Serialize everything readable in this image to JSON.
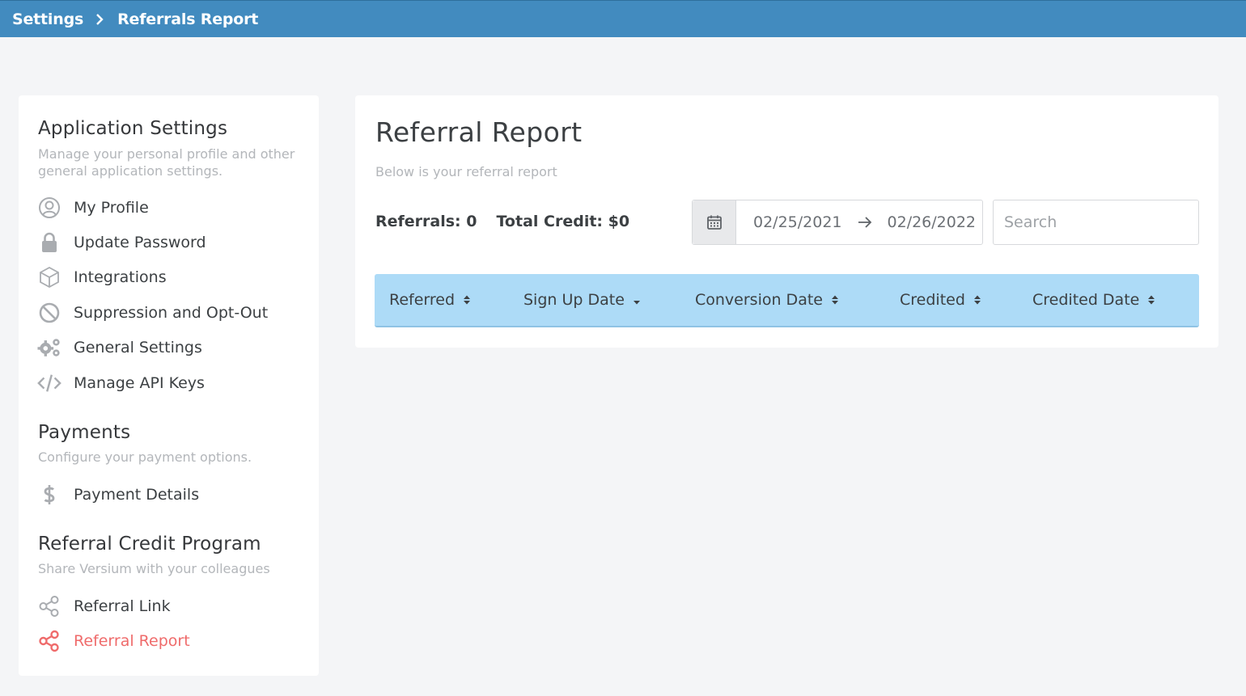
{
  "breadcrumb": {
    "items": [
      "Settings",
      "Referrals Report"
    ]
  },
  "sidebar": {
    "sections": [
      {
        "title": "Application Settings",
        "description": "Manage your personal profile and other general application settings.",
        "items": [
          {
            "label": "My Profile",
            "icon": "user-circle-icon"
          },
          {
            "label": "Update Password",
            "icon": "lock-icon"
          },
          {
            "label": "Integrations",
            "icon": "cube-icon"
          },
          {
            "label": "Suppression and Opt-Out",
            "icon": "ban-icon"
          },
          {
            "label": "General Settings",
            "icon": "gears-icon"
          },
          {
            "label": "Manage API Keys",
            "icon": "code-icon"
          }
        ]
      },
      {
        "title": "Payments",
        "description": "Configure your payment options.",
        "items": [
          {
            "label": "Payment Details",
            "icon": "dollar-icon"
          }
        ]
      },
      {
        "title": "Referral Credit Program",
        "description": "Share Versium with your colleagues",
        "items": [
          {
            "label": "Referral Link",
            "icon": "share-icon"
          },
          {
            "label": "Referral Report",
            "icon": "share-icon",
            "active": true
          }
        ]
      }
    ]
  },
  "main": {
    "title": "Referral Report",
    "subtitle": "Below is your referral report",
    "stats": {
      "referrals": "Referrals: 0",
      "total_credit": "Total Credit: $0"
    },
    "date_range": {
      "start": "02/25/2021",
      "end": "02/26/2022"
    },
    "search": {
      "placeholder": "Search",
      "value": ""
    },
    "table": {
      "columns": [
        {
          "label": "Referred",
          "sort": "unsorted"
        },
        {
          "label": "Sign Up Date",
          "sort": "descending"
        },
        {
          "label": "Conversion Date",
          "sort": "unsorted"
        },
        {
          "label": "Credited",
          "sort": "unsorted"
        },
        {
          "label": "Credited Date",
          "sort": "unsorted"
        }
      ]
    }
  },
  "colors": {
    "topbar": "#428bbf",
    "active": "#ef6b6b",
    "table_header": "#addbf7"
  }
}
